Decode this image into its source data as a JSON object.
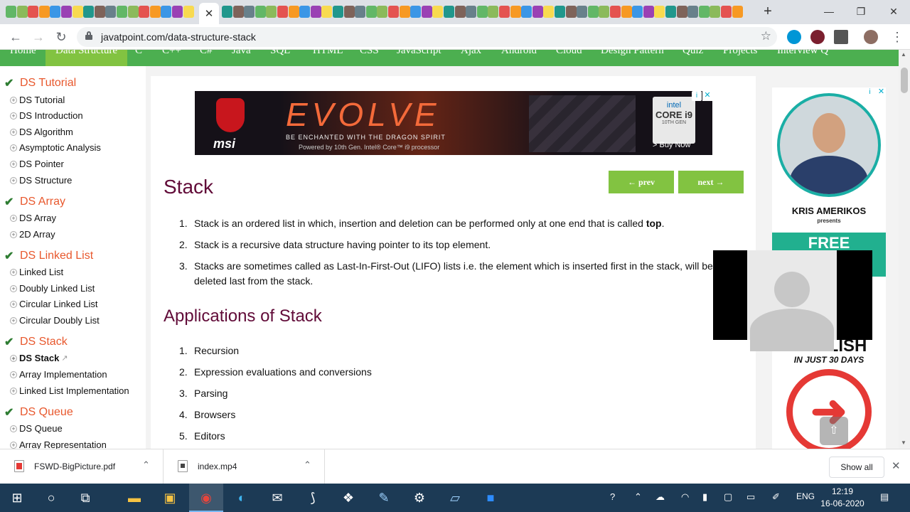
{
  "browser": {
    "tab_close_icon": "close-icon",
    "new_tab": "+",
    "window_controls": {
      "minimize": "—",
      "restore": "❐",
      "close": "✕"
    },
    "url": "javatpoint.com/data-structure-stack"
  },
  "topnav": {
    "items": [
      "Home",
      "Data Structure",
      "C",
      "C++",
      "C#",
      "Java",
      "SQL",
      "HTML",
      "CSS",
      "JavaScript",
      "Ajax",
      "Android",
      "Cloud",
      "Design Pattern",
      "Quiz",
      "Projects",
      "Interview Q"
    ],
    "active": "Data Structure"
  },
  "sidebar": {
    "sections": [
      {
        "title": "DS Tutorial",
        "items": [
          "DS Tutorial",
          "DS Introduction",
          "DS Algorithm",
          "Asymptotic Analysis",
          "DS Pointer",
          "DS Structure"
        ]
      },
      {
        "title": "DS Array",
        "items": [
          "DS Array",
          "2D Array"
        ]
      },
      {
        "title": "DS Linked List",
        "items": [
          "Linked List",
          "Doubly Linked List",
          "Circular Linked List",
          "Circular Doubly List"
        ]
      },
      {
        "title": "DS Stack",
        "items": [
          "DS Stack",
          "Array Implementation",
          "Linked List Implementation"
        ]
      },
      {
        "title": "DS Queue",
        "items": [
          "DS Queue",
          "Array Representation"
        ]
      }
    ],
    "current_item": "DS Stack"
  },
  "ad_banner": {
    "brand": "msi",
    "title": "EVOLVE",
    "sub1": "BE ENCHANTED WITH THE DRAGON SPIRIT",
    "sub2": "Powered by 10th Gen. Intel® Core™ i9 processor",
    "chip_line1": "intel",
    "chip_line2": "CORE i9",
    "chip_line3": "10TH GEN",
    "buy": "> Buy Now"
  },
  "article": {
    "prev": "← prev",
    "next": "next →",
    "title": "Stack",
    "points": [
      {
        "num": "1.",
        "text": "Stack is an ordered list in which, insertion and deletion can be performed only at one end that is called ",
        "bold": "top",
        "after": "."
      },
      {
        "num": "2.",
        "text": "Stack is a recursive data structure having pointer to its top element.",
        "bold": "",
        "after": ""
      },
      {
        "num": "3.",
        "text": "Stacks are sometimes called as Last-In-First-Out (LIFO) lists i.e. the element which is inserted first in the stack, will be deleted last from the stack.",
        "bold": "",
        "after": ""
      }
    ],
    "apps_title": "Applications of Stack",
    "applications": [
      {
        "num": "1.",
        "text": "Recursion"
      },
      {
        "num": "2.",
        "text": "Expression evaluations and conversions"
      },
      {
        "num": "3.",
        "text": "Parsing"
      },
      {
        "num": "4.",
        "text": "Browsers"
      },
      {
        "num": "5.",
        "text": "Editors"
      }
    ]
  },
  "right_ad": {
    "name": "KRIS AMERIKOS",
    "presents": "presents",
    "free": "FREE",
    "english": "ENGLISH",
    "days": "IN JUST 30 DAYS"
  },
  "downloads": {
    "items": [
      {
        "name": "FSWD-BigPicture.pdf",
        "type": "pdf"
      },
      {
        "name": "index.mp4",
        "type": "mp4"
      }
    ],
    "show_all": "Show all"
  },
  "taskbar": {
    "lang": "ENG",
    "time": "12:19",
    "date": "16-06-2020"
  },
  "colors": {
    "nav_green": "#4caf50",
    "accent_green": "#82c341",
    "heading": "#610b38",
    "section_orange": "#e8582d"
  }
}
